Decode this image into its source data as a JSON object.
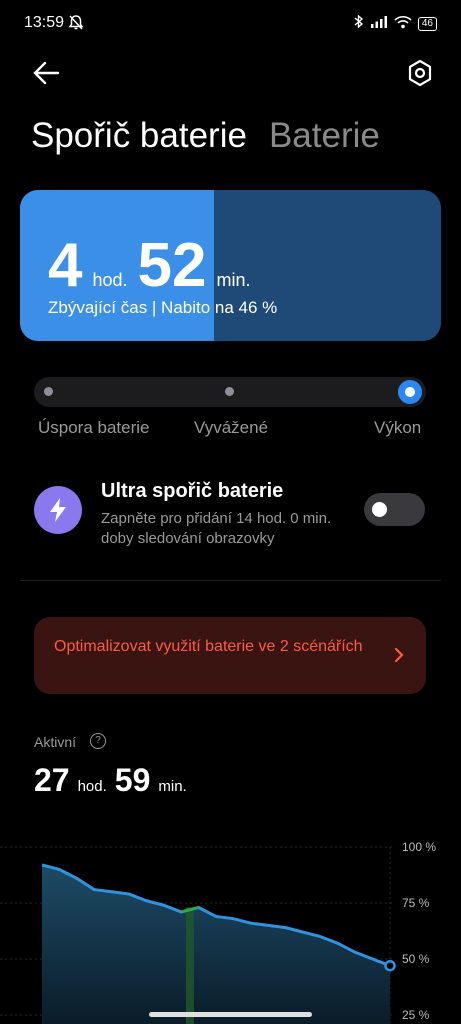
{
  "status_bar": {
    "time": "13:59",
    "battery_level": "46",
    "icons": [
      "mute-bell-icon",
      "bluetooth-icon",
      "signal-icon",
      "wifi-icon",
      "battery-icon"
    ]
  },
  "header": {
    "tabs": [
      {
        "label": "Spořič baterie",
        "active": true
      },
      {
        "label": "Baterie",
        "active": false
      }
    ]
  },
  "battery_card": {
    "hours": "4",
    "hours_unit": "hod.",
    "minutes": "52",
    "minutes_unit": "min.",
    "subtitle": "Zbývající čas | Nabito na 46 %",
    "charge_fraction": 0.46,
    "colors": {
      "fill": "#3b8fe6",
      "empty": "#1f4a78"
    }
  },
  "mode_slider": {
    "options": [
      "Úspora baterie",
      "Vyvážené",
      "Výkon"
    ],
    "selected_index": 2
  },
  "ultra_saver": {
    "title": "Ultra spořič baterie",
    "description": "Zapněte pro přidání 14 hod. 0 min. doby sledování obrazovky",
    "enabled": false
  },
  "optimize_banner": {
    "text": "Optimalizovat využití baterie ve 2 scénářích",
    "color": "#ff5a44"
  },
  "active": {
    "label": "Aktivní",
    "hours": "27",
    "hours_unit": "hod.",
    "minutes": "59",
    "minutes_unit": "min."
  },
  "chart_data": {
    "type": "area",
    "y_ticks": [
      "100 %",
      "75 %",
      "50 %",
      "25 %"
    ],
    "ylim": [
      0,
      100
    ],
    "series": [
      {
        "values": [
          92,
          90,
          86,
          81,
          80,
          79,
          76,
          74,
          71,
          73,
          69,
          68,
          66,
          65,
          64,
          62,
          60,
          57,
          53,
          50,
          47
        ]
      }
    ],
    "charging_index": 8,
    "colors": {
      "line": "#2f93e0",
      "fill_top": "#1d4b67",
      "charging": "#2fa84a"
    }
  }
}
